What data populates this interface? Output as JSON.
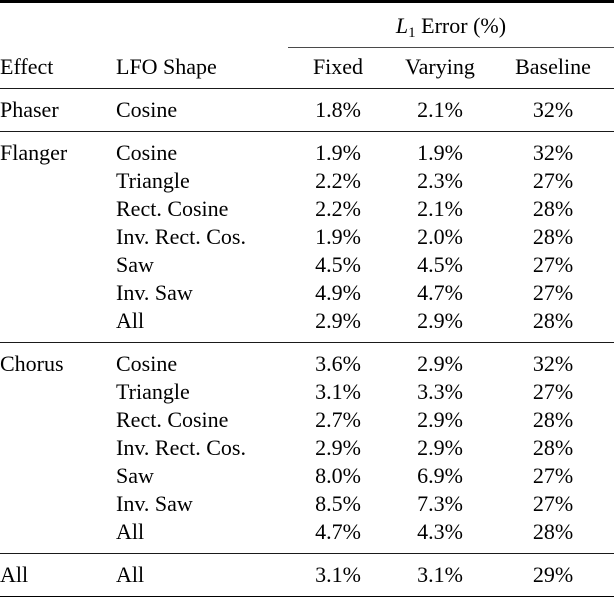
{
  "table": {
    "spanning_header": {
      "math_symbol": "L",
      "math_subscript": "1",
      "label": "Error (%)",
      "full_text": "L1 Error (%)"
    },
    "columns": [
      {
        "key": "effect",
        "label": "Effect",
        "align": "left"
      },
      {
        "key": "shape",
        "label": "LFO Shape",
        "align": "left"
      },
      {
        "key": "fixed",
        "label": "Fixed",
        "align": "center"
      },
      {
        "key": "varying",
        "label": "Varying",
        "align": "center"
      },
      {
        "key": "baseline",
        "label": "Baseline",
        "align": "center"
      }
    ],
    "groups": [
      {
        "name": "Phaser",
        "rows": [
          {
            "effect": "Phaser",
            "shape": "Cosine",
            "fixed": "1.8%",
            "varying": "2.1%",
            "baseline": "32%"
          }
        ]
      },
      {
        "name": "Flanger",
        "rows": [
          {
            "effect": "Flanger",
            "shape": "Cosine",
            "fixed": "1.9%",
            "varying": "1.9%",
            "baseline": "32%"
          },
          {
            "effect": "",
            "shape": "Triangle",
            "fixed": "2.2%",
            "varying": "2.3%",
            "baseline": "27%"
          },
          {
            "effect": "",
            "shape": "Rect. Cosine",
            "fixed": "2.2%",
            "varying": "2.1%",
            "baseline": "28%"
          },
          {
            "effect": "",
            "shape": "Inv. Rect. Cos.",
            "fixed": "1.9%",
            "varying": "2.0%",
            "baseline": "28%"
          },
          {
            "effect": "",
            "shape": "Saw",
            "fixed": "4.5%",
            "varying": "4.5%",
            "baseline": "27%"
          },
          {
            "effect": "",
            "shape": "Inv. Saw",
            "fixed": "4.9%",
            "varying": "4.7%",
            "baseline": "27%"
          },
          {
            "effect": "",
            "shape": "All",
            "fixed": "2.9%",
            "varying": "2.9%",
            "baseline": "28%"
          }
        ]
      },
      {
        "name": "Chorus",
        "rows": [
          {
            "effect": "Chorus",
            "shape": "Cosine",
            "fixed": "3.6%",
            "varying": "2.9%",
            "baseline": "32%"
          },
          {
            "effect": "",
            "shape": "Triangle",
            "fixed": "3.1%",
            "varying": "3.3%",
            "baseline": "27%"
          },
          {
            "effect": "",
            "shape": "Rect. Cosine",
            "fixed": "2.7%",
            "varying": "2.9%",
            "baseline": "28%"
          },
          {
            "effect": "",
            "shape": "Inv. Rect. Cos.",
            "fixed": "2.9%",
            "varying": "2.9%",
            "baseline": "28%"
          },
          {
            "effect": "",
            "shape": "Saw",
            "fixed": "8.0%",
            "varying": "6.9%",
            "baseline": "27%"
          },
          {
            "effect": "",
            "shape": "Inv. Saw",
            "fixed": "8.5%",
            "varying": "7.3%",
            "baseline": "27%"
          },
          {
            "effect": "",
            "shape": "All",
            "fixed": "4.7%",
            "varying": "4.3%",
            "baseline": "28%"
          }
        ]
      },
      {
        "name": "All",
        "rows": [
          {
            "effect": "All",
            "shape": "All",
            "fixed": "3.1%",
            "varying": "3.1%",
            "baseline": "29%"
          }
        ]
      }
    ]
  },
  "style": {
    "rule_color": "#000000",
    "cmidrule_color": "#4a4a4a",
    "text_color": "#000000",
    "background": "#ffffff"
  }
}
